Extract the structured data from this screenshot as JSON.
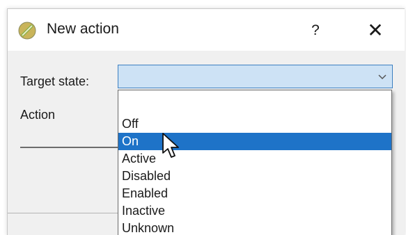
{
  "dialog": {
    "title": "New action",
    "help_label": "?",
    "close_label": "✕",
    "icon": "app-icon"
  },
  "form": {
    "target_state_label": "Target state:",
    "action_label": "Action",
    "target_state_value": ""
  },
  "dropdown": {
    "selected_index": 1,
    "options": [
      "Off",
      "On",
      "Active",
      "Disabled",
      "Enabled",
      "Inactive",
      "Unknown"
    ]
  },
  "colors": {
    "selection": "#1e73c8",
    "select_focus_bg": "#cde2f5",
    "select_border": "#3c7fc1"
  }
}
